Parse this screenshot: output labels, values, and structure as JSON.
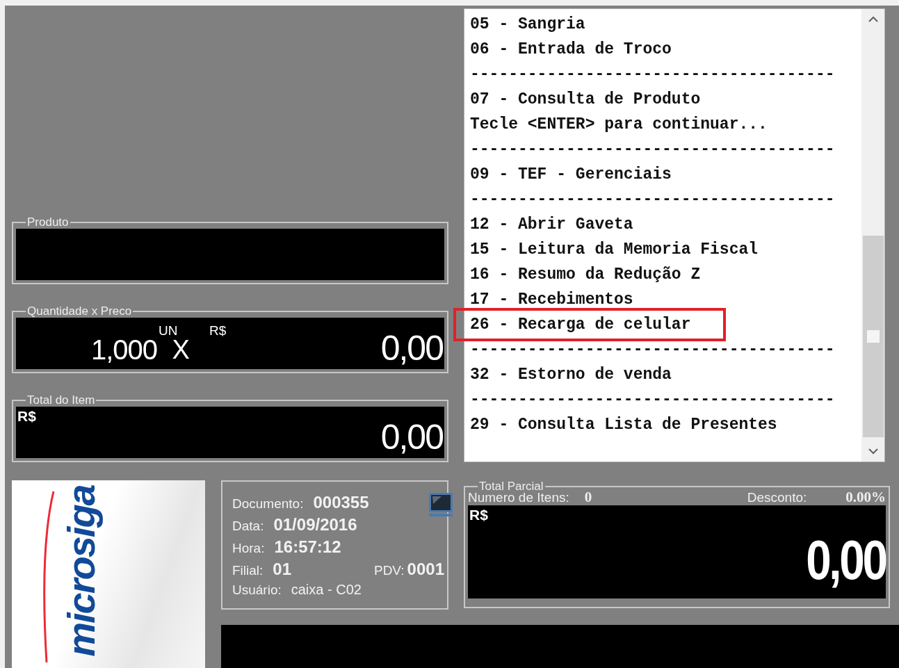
{
  "produto": {
    "label": "Produto"
  },
  "quantidade_preco": {
    "label": "Quantidade x Preco",
    "quantity": "1,000",
    "unit": "UN",
    "times": "X",
    "currency": "R$",
    "price": "0,00"
  },
  "total_item": {
    "label": "Total do Item",
    "currency": "R$",
    "value": "0,00"
  },
  "menu": {
    "lines": [
      {
        "kind": "item",
        "text": "05 - Sangria",
        "highlighted": false
      },
      {
        "kind": "item",
        "text": "06 - Entrada de Troco",
        "highlighted": false
      },
      {
        "kind": "separator",
        "text": "--------------------------------------"
      },
      {
        "kind": "item",
        "text": "07 - Consulta de Produto",
        "highlighted": false
      },
      {
        "kind": "item",
        "text": "Tecle <ENTER> para continuar...",
        "highlighted": false
      },
      {
        "kind": "separator",
        "text": "--------------------------------------"
      },
      {
        "kind": "item",
        "text": "09 - TEF - Gerenciais",
        "highlighted": false
      },
      {
        "kind": "separator",
        "text": "--------------------------------------"
      },
      {
        "kind": "item",
        "text": "12 - Abrir Gaveta",
        "highlighted": false
      },
      {
        "kind": "item",
        "text": "15 - Leitura da Memoria Fiscal",
        "highlighted": false
      },
      {
        "kind": "item",
        "text": "16 - Resumo da Redução Z",
        "highlighted": false
      },
      {
        "kind": "item",
        "text": "17 - Recebimentos",
        "highlighted": false
      },
      {
        "kind": "item",
        "text": "26 - Recarga de celular",
        "highlighted": true
      },
      {
        "kind": "separator",
        "text": "--------------------------------------"
      },
      {
        "kind": "item",
        "text": "32 - Estorno de venda",
        "highlighted": false
      },
      {
        "kind": "separator",
        "text": "--------------------------------------"
      },
      {
        "kind": "item",
        "text": "29 - Consulta Lista de Presentes",
        "highlighted": false
      }
    ]
  },
  "logo": {
    "text": "microsiga"
  },
  "document_info": {
    "rows": [
      {
        "label": "Documento:",
        "value": "000355",
        "kind": "bold"
      },
      {
        "label": "Data:",
        "value": "01/09/2016",
        "kind": "bold"
      },
      {
        "label": "Hora:",
        "value": "16:57:12",
        "kind": "bold"
      },
      {
        "label": "Filial:",
        "value": "01",
        "kind": "bold",
        "extra_label": "PDV:",
        "extra_value": "0001"
      },
      {
        "label": "Usuário:",
        "value": "caixa - C02",
        "kind": "plain"
      }
    ]
  },
  "total_parcial": {
    "label": "Total Parcial",
    "items_label": "Numero de Itens:",
    "items_value": "0",
    "discount_label": "Desconto:",
    "discount_value": "0.00%",
    "currency": "R$",
    "value": "0,00"
  }
}
